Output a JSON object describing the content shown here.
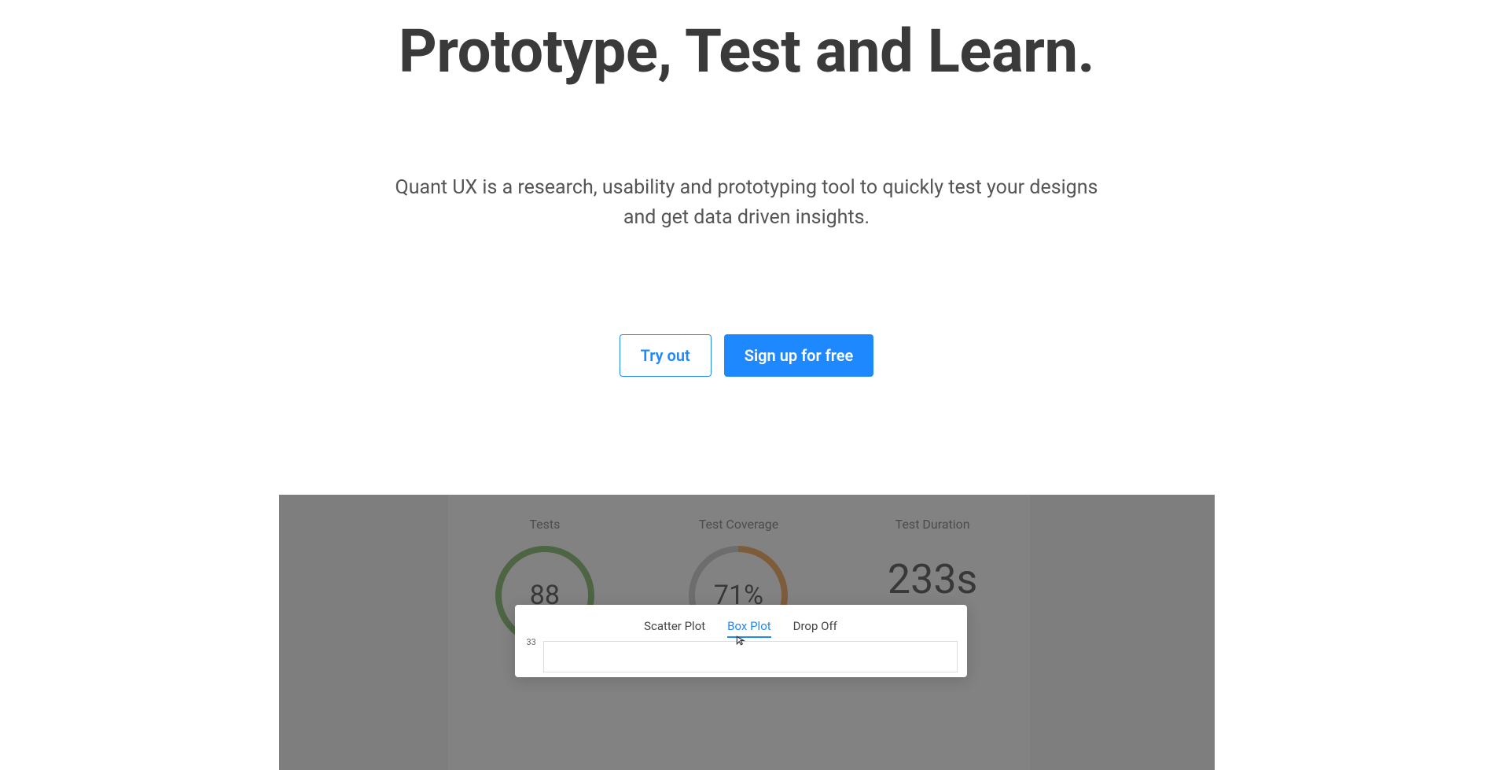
{
  "hero": {
    "title": "Prototype, Test and Learn.",
    "subtitle": "Quant UX is a research, usability and prototyping tool to quickly test your designs and get data driven insights."
  },
  "cta": {
    "try": "Try out",
    "signup": "Sign up for free"
  },
  "dashboard": {
    "stats": {
      "tests": {
        "label": "Tests",
        "value": "88"
      },
      "coverage": {
        "label": "Test Coverage",
        "value": "71%"
      },
      "duration": {
        "label": "Test Duration",
        "value": "233s"
      }
    },
    "popup": {
      "tabs": {
        "scatter": "Scatter Plot",
        "box": "Box Plot",
        "dropoff": "Drop Off"
      },
      "y_tick": "33"
    }
  },
  "colors": {
    "accent": "#1e88ff",
    "ring_green": "#6aa84f",
    "ring_orange": "#e69138",
    "ring_gray": "#bdbdbd"
  }
}
